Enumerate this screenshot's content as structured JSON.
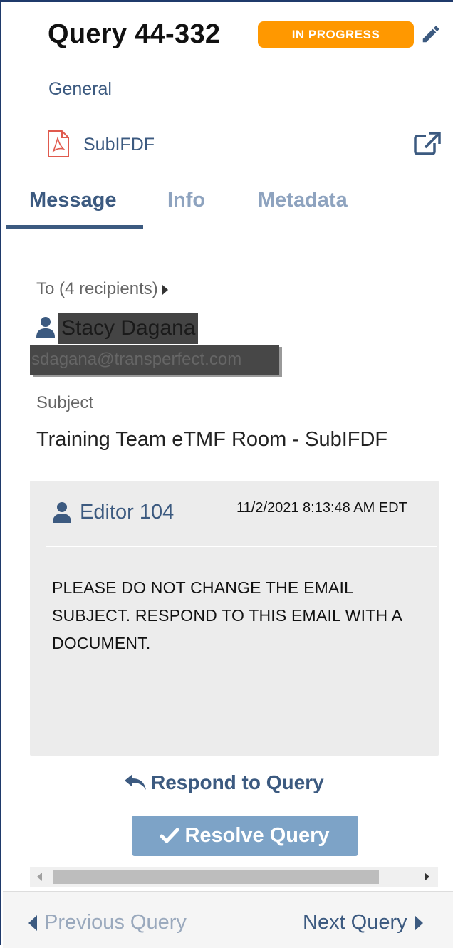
{
  "query": {
    "title": "Query 44-332",
    "status": "IN PROGRESS",
    "category": "General",
    "file_name": "SubIFDF"
  },
  "tabs": [
    {
      "label": "Message",
      "active": true
    },
    {
      "label": "Info",
      "active": false
    },
    {
      "label": "Metadata",
      "active": false
    }
  ],
  "message": {
    "recipients_label": "To (4 recipients)",
    "recipient_name": "Stacy Dagana",
    "recipient_email": "sdagana@transperfect.com",
    "subject_label": "Subject",
    "subject": "Training Team eTMF Room - SubIFDF",
    "author": "Editor 104",
    "timestamp": "11/2/2021 8:13:48 AM EDT",
    "body": "PLEASE DO NOT CHANGE THE EMAIL SUBJECT. RESPOND TO THIS EMAIL WITH A DOCUMENT."
  },
  "actions": {
    "respond_label": "Respond to Query",
    "resolve_label": "Resolve Query"
  },
  "navigation": {
    "previous_label": "Previous Query",
    "next_label": "Next Query"
  },
  "icons": {
    "edit": "pencil-icon",
    "file": "pdf-icon",
    "open_external": "external-link-icon",
    "user": "user-icon",
    "respond": "reply-icon",
    "resolve": "check-icon"
  },
  "colors": {
    "accent": "#3c5a80",
    "status": "#ff9800",
    "resolve_button": "#7da3c7",
    "pdf": "#e05a4e"
  }
}
